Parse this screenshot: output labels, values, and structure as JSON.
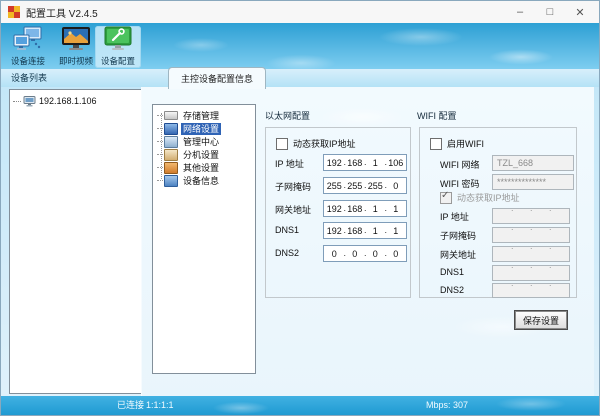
{
  "window": {
    "title": "配置工具 V2.4.5"
  },
  "window_controls": {
    "minimize": "–",
    "maximize": "□",
    "close": "✕"
  },
  "toolbar": {
    "buttons": [
      {
        "label": "设备连接",
        "icon": "device-connect-icon",
        "selected": false
      },
      {
        "label": "即时视频",
        "icon": "live-video-icon",
        "selected": false
      },
      {
        "label": "设备配置",
        "icon": "device-config-icon",
        "selected": true
      }
    ]
  },
  "device_list": {
    "header": "设备列表",
    "items": [
      {
        "label": "192.168.1.106",
        "icon": "device-node-icon"
      }
    ]
  },
  "tabs": {
    "active": "主控设备配置信息"
  },
  "config_tree": {
    "items": [
      {
        "label": "存储管理",
        "icon": "storage-icon",
        "selected": false
      },
      {
        "label": "网络设置",
        "icon": "network-settings-icon",
        "selected": true
      },
      {
        "label": "管理中心",
        "icon": "management-center-icon",
        "selected": false
      },
      {
        "label": "分机设置",
        "icon": "extension-settings-icon",
        "selected": false
      },
      {
        "label": "其他设置",
        "icon": "other-settings-icon",
        "selected": false
      },
      {
        "label": "设备信息",
        "icon": "device-info-icon",
        "selected": false
      }
    ]
  },
  "ethernet": {
    "title": "以太网配置",
    "dhcp": {
      "label": "动态获取IP地址",
      "checked": false
    },
    "rows": [
      {
        "label": "IP 地址",
        "segments": [
          "192",
          "168",
          "1",
          "106"
        ]
      },
      {
        "label": "子网掩码",
        "segments": [
          "255",
          "255",
          "255",
          "0"
        ]
      },
      {
        "label": "网关地址",
        "segments": [
          "192",
          "168",
          "1",
          "1"
        ]
      },
      {
        "label": "DNS1",
        "segments": [
          "192",
          "168",
          "1",
          "1"
        ]
      },
      {
        "label": "DNS2",
        "segments": [
          "0",
          "0",
          "0",
          "0"
        ]
      }
    ]
  },
  "wifi": {
    "title": "WIFI 配置",
    "enable": {
      "label": "启用WIFI",
      "checked": false
    },
    "network": {
      "label": "WIFI 网络",
      "value": "TZL_668"
    },
    "password": {
      "label": "WIFI 密码",
      "value": "**************"
    },
    "dhcp": {
      "label": "动态获取IP地址",
      "checked": true,
      "disabled": true
    },
    "rows": [
      {
        "label": "IP 地址",
        "segments": [
          "",
          "",
          "",
          ""
        ]
      },
      {
        "label": "子网掩码",
        "segments": [
          "",
          "",
          "",
          ""
        ]
      },
      {
        "label": "网关地址",
        "segments": [
          "",
          "",
          "",
          ""
        ]
      },
      {
        "label": "DNS1",
        "segments": [
          "",
          "",
          "",
          ""
        ]
      },
      {
        "label": "DNS2",
        "segments": [
          "",
          "",
          "",
          ""
        ]
      }
    ]
  },
  "actions": {
    "save": "保存设置"
  },
  "status_bar": {
    "connection": "已连接",
    "channels": "1:1:1:1",
    "bitrate": "Mbps: 307"
  },
  "colors": {
    "toolbar_top": "#2da0d4",
    "toolbar_bottom": "#7ecdf0",
    "status_bar": "#2aa6dc",
    "selection": "#2f63b5"
  }
}
